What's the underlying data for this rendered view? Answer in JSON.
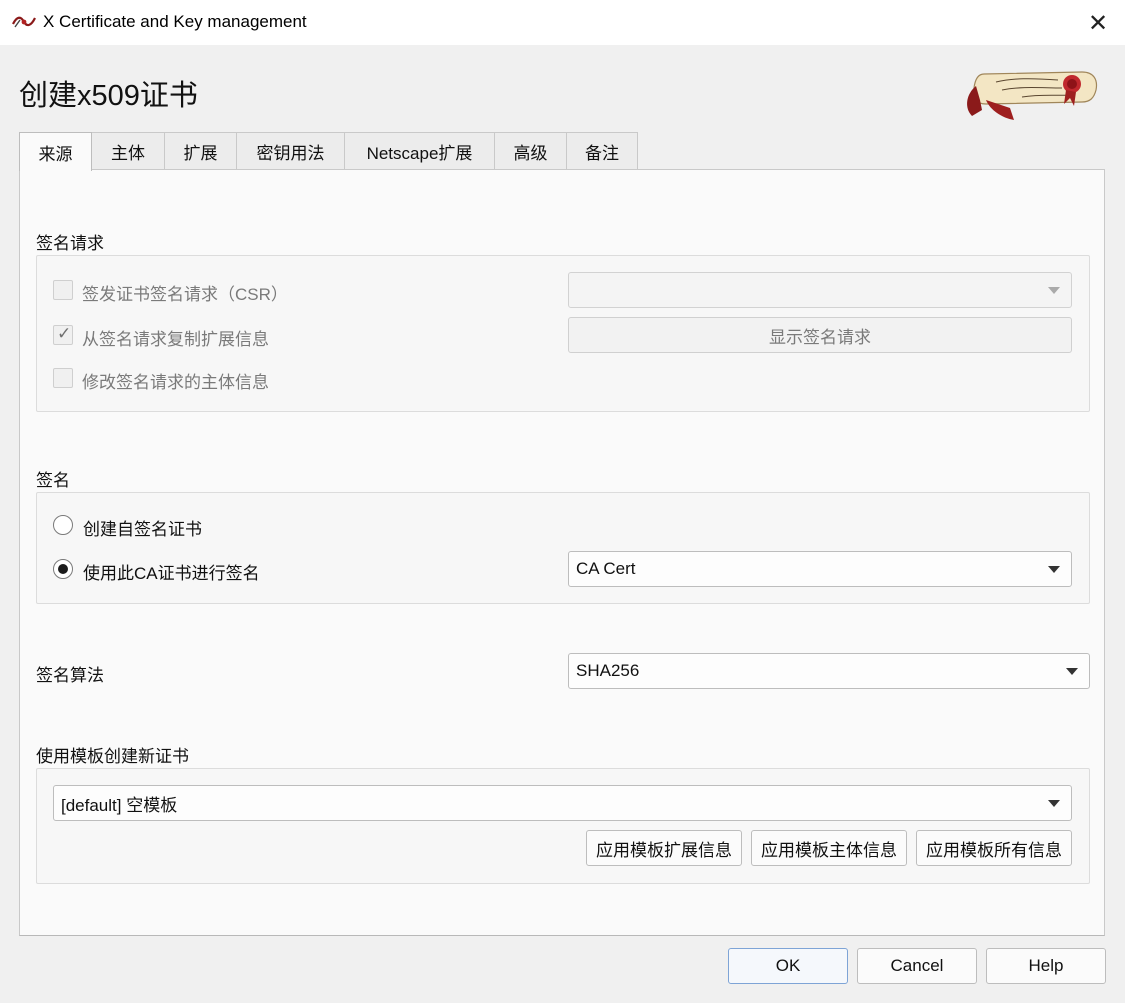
{
  "window": {
    "title": "X Certificate and Key management",
    "close_glyph": "✕"
  },
  "dialog": {
    "title": "创建x509证书"
  },
  "tabs": [
    {
      "label": "来源"
    },
    {
      "label": "主体"
    },
    {
      "label": "扩展"
    },
    {
      "label": "密钥用法"
    },
    {
      "label": "Netscape扩展"
    },
    {
      "label": "高级"
    },
    {
      "label": "备注"
    }
  ],
  "signing_request": {
    "heading": "签名请求",
    "sign_csr_label": "签发证书签名请求（CSR）",
    "sign_csr_checked": false,
    "csr_select_value": "",
    "copy_extensions_label": "从签名请求复制扩展信息",
    "copy_extensions_checked": true,
    "check_glyph": "✓",
    "show_request_button": "显示签名请求",
    "modify_subject_label": "修改签名请求的主体信息",
    "modify_subject_checked": false
  },
  "signing": {
    "heading": "签名",
    "self_signed_label": "创建自签名证书",
    "use_ca_label": "使用此CA证书进行签名",
    "selected_option": "use_ca",
    "ca_select_value": "CA Cert"
  },
  "signature_algorithm": {
    "label": "签名算法",
    "value": "SHA256"
  },
  "template": {
    "heading": "使用模板创建新证书",
    "select_value": "[default] 空模板",
    "apply_extensions_button": "应用模板扩展信息",
    "apply_subject_button": "应用模板主体信息",
    "apply_all_button": "应用模板所有信息"
  },
  "footer": {
    "ok": "OK",
    "cancel": "Cancel",
    "help": "Help"
  },
  "colors": {
    "accent_border": "#7ea4d6",
    "panel_bg": "#fafafa",
    "window_bg": "#f0f0f0"
  }
}
